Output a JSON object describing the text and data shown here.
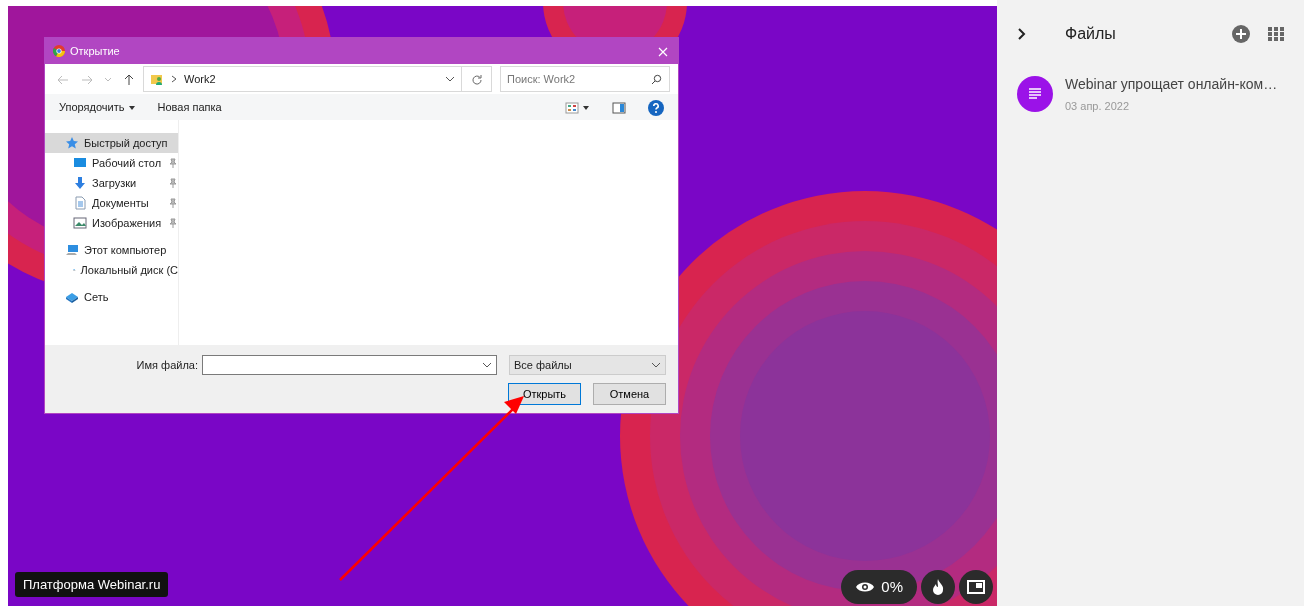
{
  "stage": {
    "brand_badge": "Платформа Webinar.ru",
    "views": "0%"
  },
  "dialog": {
    "title": "Открытие",
    "path": "Work2",
    "search": {
      "placeholder": "Поиск: Work2"
    },
    "toolbar": [
      {
        "label": "Упорядочить",
        "dropdown": true
      },
      {
        "label": "Новая папка",
        "dropdown": false
      }
    ],
    "nav": [
      {
        "label": "Быстрый доступ",
        "kind": "star",
        "selected": true,
        "children": [
          {
            "label": "Рабочий стол",
            "kind": "desktop",
            "pinned": true,
            "selected": false
          },
          {
            "label": "Загрузки",
            "kind": "download",
            "pinned": true,
            "selected": false
          },
          {
            "label": "Документы",
            "kind": "document",
            "pinned": true,
            "selected": false
          },
          {
            "label": "Изображения",
            "kind": "image",
            "pinned": true,
            "selected": false
          }
        ]
      },
      {
        "label": "Этот компьютер",
        "kind": "computer",
        "selected": false,
        "children": [
          {
            "label": "Локальный диск (С",
            "kind": "disk",
            "pinned": false,
            "selected": false
          }
        ]
      },
      {
        "label": "Сеть",
        "kind": "network",
        "selected": false
      }
    ],
    "filename_label": "Имя файла:",
    "filetype": "Все файлы",
    "buttons": [
      {
        "label": "Открыть",
        "default": true
      },
      {
        "label": "Отмена",
        "default": false
      }
    ]
  },
  "files_panel": {
    "title": "Файлы",
    "files": [
      {
        "title": "Webinar упрощает онлайн-ком…",
        "date": "03 апр. 2022"
      }
    ]
  }
}
